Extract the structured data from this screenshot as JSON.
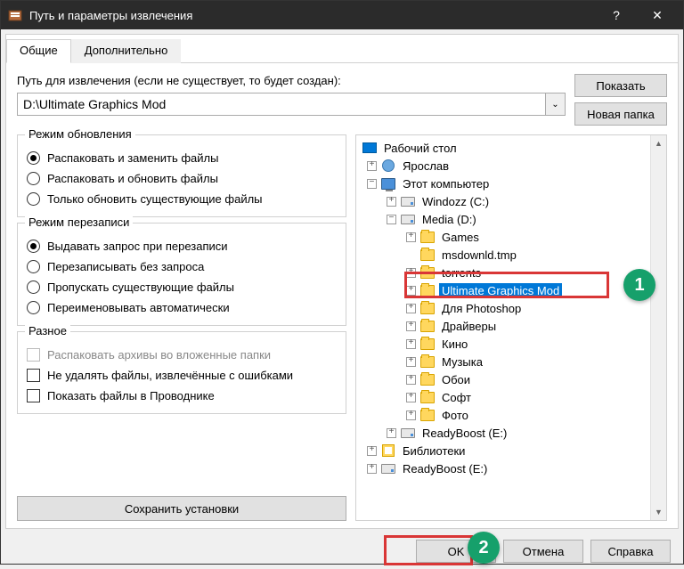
{
  "titlebar": {
    "title": "Путь и параметры извлечения"
  },
  "tabs": {
    "general": "Общие",
    "advanced": "Дополнительно"
  },
  "path": {
    "label": "Путь для извлечения (если не существует, то будет создан):",
    "value": "D:\\Ultimate Graphics Mod",
    "show_btn": "Показать",
    "newfolder_btn": "Новая папка"
  },
  "group_update": {
    "title": "Режим обновления",
    "opt1": "Распаковать и заменить файлы",
    "opt2": "Распаковать и обновить файлы",
    "opt3": "Только обновить существующие файлы"
  },
  "group_overwrite": {
    "title": "Режим перезаписи",
    "opt1": "Выдавать запрос при перезаписи",
    "opt2": "Перезаписывать без запроса",
    "opt3": "Пропускать существующие файлы",
    "opt4": "Переименовывать автоматически"
  },
  "group_misc": {
    "title": "Разное",
    "opt1": "Распаковать архивы во вложенные папки",
    "opt2": "Не удалять файлы, извлечённые с ошибками",
    "opt3": "Показать файлы в Проводнике"
  },
  "save_btn": "Сохранить установки",
  "tree": {
    "desktop": "Рабочий стол",
    "user": "Ярослав",
    "thispc": "Этот компьютер",
    "drive_c": "Windozz (C:)",
    "drive_d": "Media (D:)",
    "d_games": "Games",
    "d_msdownld": "msdownld.tmp",
    "d_torrents": "torrents",
    "d_ugm": "Ultimate Graphics Mod",
    "d_photoshop": "Для Photoshop",
    "d_drivers": "Драйверы",
    "d_movies": "Кино",
    "d_music": "Музыка",
    "d_wallpapers": "Обои",
    "d_soft": "Софт",
    "d_photo": "Фото",
    "drive_e1": "ReadyBoost (E:)",
    "libraries": "Библиотеки",
    "drive_e2": "ReadyBoost (E:)"
  },
  "footer": {
    "ok": "OK",
    "cancel": "Отмена",
    "help": "Справка"
  },
  "callouts": {
    "c1": "1",
    "c2": "2"
  }
}
